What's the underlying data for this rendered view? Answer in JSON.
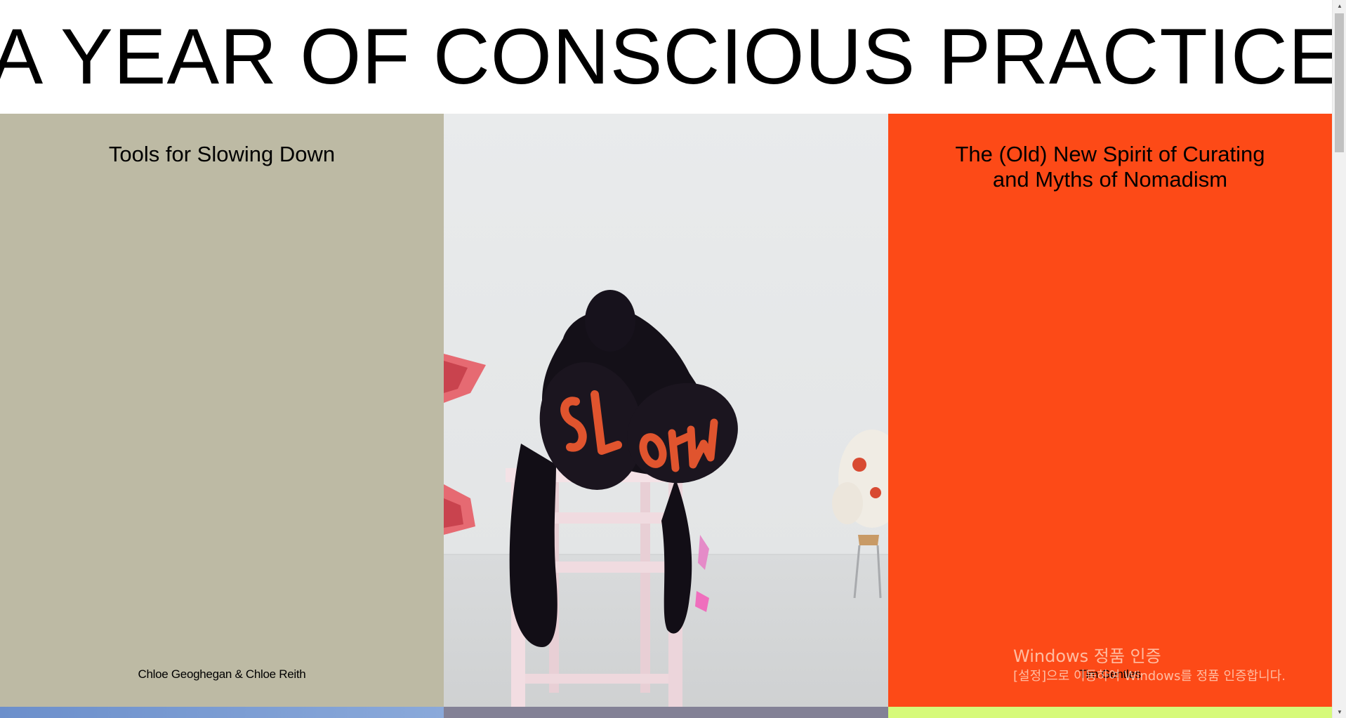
{
  "header": {
    "title": "A YEAR OF CONSCIOUS PRACTICE"
  },
  "cards": [
    {
      "title": "Tools for Slowing Down",
      "author": "Chloe Geoghegan & Chloe Reith",
      "color": "#bdbaa4"
    },
    {
      "image": "slow-sculpture-photo",
      "color": "#e7e9ea"
    },
    {
      "title_line1": "The (Old) New Spirit of Curating",
      "title_line2": "and Myths of Nomadism",
      "author": "Tim Gentles",
      "color": "#fd4a17"
    }
  ],
  "next_row_colors": [
    "#6c8fcb",
    "#838196",
    "#d6fa7a"
  ],
  "windows_activation": {
    "title": "Windows 정품 인증",
    "subtitle": "[설정]으로 이동하여 Windows를 정품 인증합니다."
  },
  "scrollbar": {
    "up_icon": "arrow-up-icon",
    "down_icon": "arrow-down-icon"
  }
}
